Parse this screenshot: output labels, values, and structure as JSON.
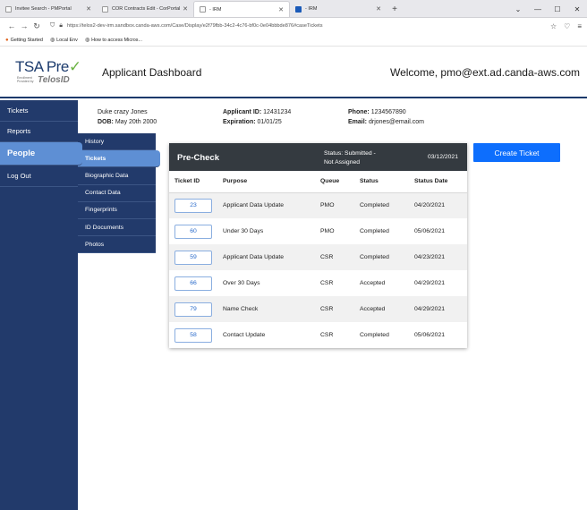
{
  "browser": {
    "tabs": [
      {
        "label": "Invitee Search - PMPortal",
        "icon": "page-icon"
      },
      {
        "label": "COR Contracts Edit - CorPortal",
        "icon": "page-icon"
      },
      {
        "label": "- IRM",
        "icon": "page-icon",
        "active": true
      },
      {
        "label": "- IRM",
        "icon": "app-icon"
      }
    ],
    "url": "https://telos2-dev-irm.sandbox.canda-aws.com/Case/Display/e2f79fbb-34c2-4c76-bf0c-0e04bbbde876#caseTickets",
    "bookmarks": [
      "Getting Started",
      "Local Env",
      "How to access Micros..."
    ]
  },
  "header": {
    "logo_brand": "TSA Pre",
    "logo_sub": "Enrollment Provided by",
    "logo_telos": "TelosID",
    "title": "Applicant Dashboard",
    "welcome": "Welcome, pmo@ext.ad.canda-aws.com"
  },
  "sidebar": {
    "items": [
      "Tickets",
      "Reports",
      "People",
      "Log Out"
    ]
  },
  "submenu": {
    "items": [
      "History",
      "Tickets",
      "Biographic Data",
      "Contact Data",
      "Fingerprints",
      "ID Documents",
      "Photos"
    ]
  },
  "applicant": {
    "name": "Duke crazy Jones",
    "dob_label": "DOB:",
    "dob": "May 20th 2000",
    "id_label": "Applicant ID:",
    "id": "12431234",
    "exp_label": "Expiration:",
    "exp": "01/01/25",
    "phone_label": "Phone:",
    "phone": "1234567890",
    "email_label": "Email:",
    "email": "drjones@email.com"
  },
  "panel": {
    "title": "Pre-Check",
    "status_line1": "Status: Submitted -",
    "status_line2": "Not Assigned",
    "date": "03/12/2021",
    "columns": [
      "Ticket ID",
      "Purpose",
      "Queue",
      "Status",
      "Status Date"
    ],
    "rows": [
      [
        "23",
        "Applicant Data Update",
        "PMO",
        "Completed",
        "04/20/2021"
      ],
      [
        "60",
        "Under 30 Days",
        "PMO",
        "Completed",
        "05/06/2021"
      ],
      [
        "59",
        "Applicant Data Update",
        "CSR",
        "Completed",
        "04/23/2021"
      ],
      [
        "66",
        "Over 30 Days",
        "CSR",
        "Accepted",
        "04/29/2021"
      ],
      [
        "79",
        "Name Check",
        "CSR",
        "Accepted",
        "04/29/2021"
      ],
      [
        "58",
        "Contact Update",
        "CSR",
        "Completed",
        "05/06/2021"
      ]
    ]
  },
  "create_button": "Create Ticket",
  "colors": {
    "sidebar": "#223a6b",
    "active": "#5e8fd4",
    "panel_header": "#343a40",
    "primary_button": "#0d6efd"
  }
}
